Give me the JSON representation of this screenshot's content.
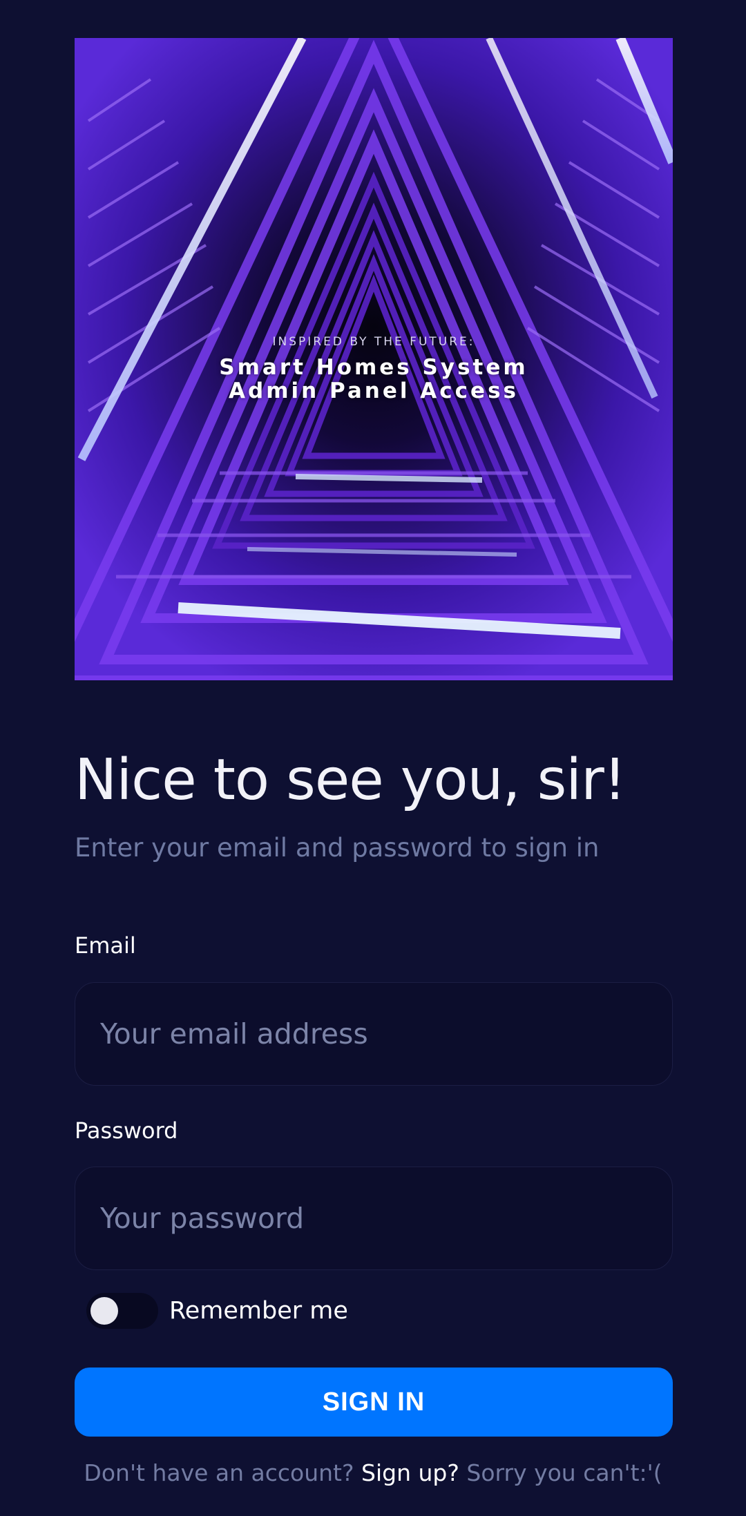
{
  "hero": {
    "eyebrow": "INSPIRED BY THE FUTURE:",
    "title_line1": "Smart Homes System",
    "title_line2": "Admin Panel Access"
  },
  "greeting": "Nice to see you, sir!",
  "subtitle": "Enter your email and password to sign in",
  "form": {
    "email_label": "Email",
    "email_placeholder": "Your email address",
    "password_label": "Password",
    "password_placeholder": "Your password",
    "remember_label": "Remember me",
    "remember_checked": false,
    "submit_label": "SIGN IN"
  },
  "footer": {
    "prefix": "Don't have an account?",
    "link": "Sign up?",
    "suffix": "Sorry you can't:'("
  },
  "colors": {
    "background": "#0e1032",
    "accent": "#0075ff",
    "muted_text": "#737ca3"
  }
}
